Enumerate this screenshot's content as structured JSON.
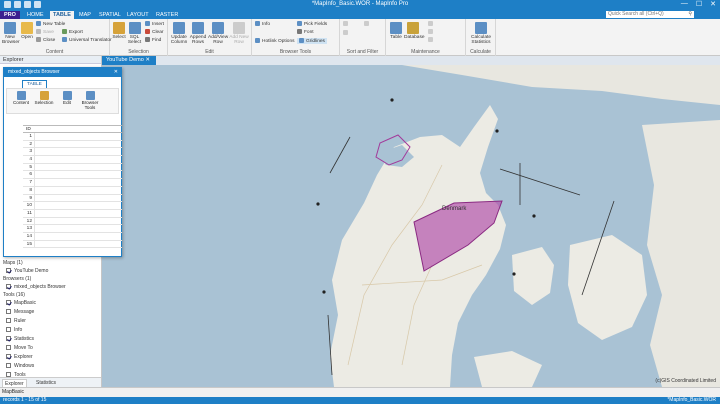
{
  "window": {
    "title": "*MapInfo_Basic.WOR - MapInfo Pro",
    "minimize": "—",
    "maximize": "☐",
    "close": "✕"
  },
  "ribbon_tabs": [
    "PRO",
    "HOME",
    "TABLE",
    "MAP",
    "SPATIAL",
    "LAYOUT",
    "RASTER"
  ],
  "active_tab": "TABLE",
  "search": {
    "placeholder": "Quick Search all (Ctrl+Q)"
  },
  "ribbon": {
    "content": {
      "label": "Content",
      "new_browser": "New Browser",
      "open": "Open",
      "new_table": "New Table",
      "save": "Save",
      "close": "Close",
      "export": "Export",
      "universal_translator": "Universal Translator"
    },
    "selection": {
      "label": "Selection",
      "select": "Select",
      "sql_select": "SQL Select",
      "insert": "Insert",
      "clear": "Clear",
      "find": "Find"
    },
    "edit": {
      "label": "Edit",
      "update_column": "Update Column",
      "append_rows": "Append Rows",
      "add_view_row": "Add/View Row",
      "add_new_row": "Add New Row"
    },
    "browser_tools": {
      "label": "Browser Tools",
      "info": "Info",
      "hotlink_options": "Hotlink Options",
      "pick_fields": "Pick Fields",
      "font": "Font",
      "gridlines": "Gridlines"
    },
    "sort_filter": {
      "label": "Sort and Filter"
    },
    "maintenance": {
      "label": "Maintenance",
      "table": "Table",
      "database": "Database"
    },
    "calculate": {
      "label": "Calculate",
      "calculate_statistics": "Calculate Statistics"
    }
  },
  "explorer": {
    "title": "Explorer",
    "windows_label": "Wi",
    "maps_section": "Maps (1)",
    "maps": [
      "YouTube Demo"
    ],
    "browsers_section": "Browsers (1)",
    "browsers": [
      "mixed_objects Browser"
    ],
    "tools_section": "Tools (16)",
    "tools": [
      {
        "label": "MapBasic",
        "checked": true
      },
      {
        "label": "Message",
        "checked": false
      },
      {
        "label": "Ruler",
        "checked": false
      },
      {
        "label": "Info",
        "checked": false
      },
      {
        "label": "Statistics",
        "checked": true
      },
      {
        "label": "Move To",
        "checked": false
      },
      {
        "label": "Explorer",
        "checked": true
      },
      {
        "label": "Windows",
        "checked": false
      },
      {
        "label": "Tools",
        "checked": false
      }
    ],
    "tabs": [
      "Explorer",
      "Statistics"
    ]
  },
  "map_tab": {
    "title": "YouTube Demo"
  },
  "map": {
    "label": "Denmark",
    "attribution": "(c)GIS Coordinated Limited",
    "water_color": "#a9c2d4",
    "land_color": "#ecebe4",
    "polygon_color": "#b04aa8"
  },
  "browser_window": {
    "title": "mixed_objects Browser",
    "tab": "TABLE",
    "buttons": [
      "Content",
      "Selection",
      "Edit",
      "Browser Tools"
    ],
    "column_header": "ID",
    "rows": [
      "1",
      "2",
      "3",
      "4",
      "5",
      "6",
      "7",
      "8",
      "9",
      "10",
      "11",
      "12",
      "13",
      "14",
      "15"
    ]
  },
  "status": {
    "mapbasic": "MapBasic",
    "records": "records 1 - 15 of 15",
    "workspace": "*MapInfo_Basic.WOR"
  }
}
